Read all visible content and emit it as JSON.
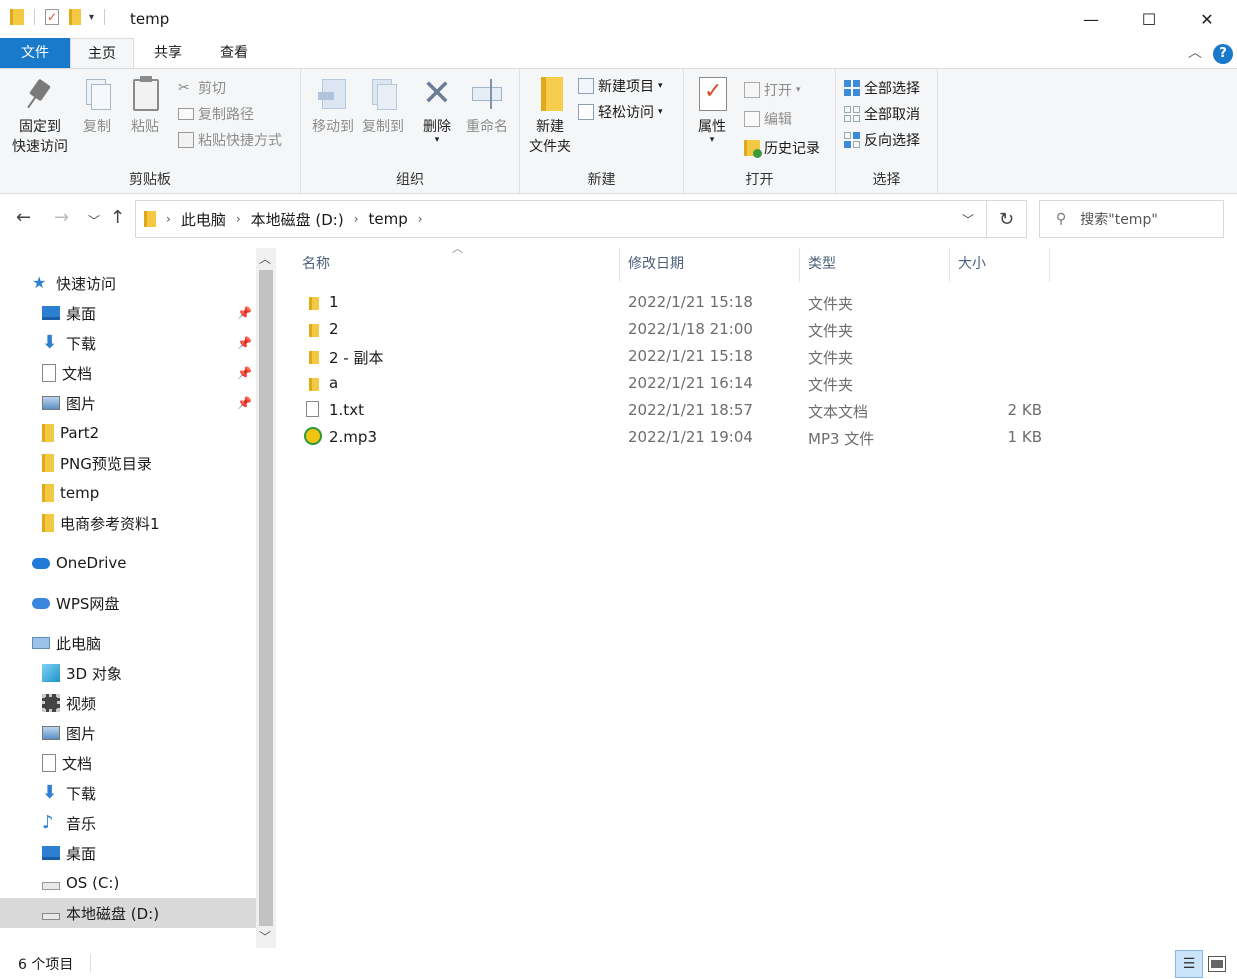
{
  "window": {
    "title": "temp",
    "controls": {
      "minimize": "—",
      "maximize": "☐",
      "close": "✕"
    }
  },
  "tabs": [
    {
      "label": "文件"
    },
    {
      "label": "主页"
    },
    {
      "label": "共享"
    },
    {
      "label": "查看"
    }
  ],
  "ribbon": {
    "clipboard": {
      "label": "剪贴板",
      "pin_line1": "固定到",
      "pin_line2": "快速访问",
      "copy": "复制",
      "paste": "粘贴",
      "cut": "剪切",
      "copy_path": "复制路径",
      "paste_shortcut": "粘贴快捷方式"
    },
    "organize": {
      "label": "组织",
      "move_to": "移动到",
      "copy_to": "复制到",
      "delete": "删除",
      "rename": "重命名"
    },
    "new": {
      "label": "新建",
      "new_folder_line1": "新建",
      "new_folder_line2": "文件夹",
      "new_item": "新建项目",
      "easy_access": "轻松访问"
    },
    "open": {
      "label": "打开",
      "properties": "属性",
      "open": "打开",
      "edit": "编辑",
      "history": "历史记录"
    },
    "select": {
      "label": "选择",
      "select_all": "全部选择",
      "select_none": "全部取消",
      "invert": "反向选择"
    }
  },
  "address": {
    "crumbs": [
      "此电脑",
      "本地磁盘 (D:)",
      "temp"
    ],
    "search_placeholder": "搜索\"temp\""
  },
  "nav": {
    "quick_access": "快速访问",
    "quick_items": [
      "桌面",
      "下载",
      "文档",
      "图片",
      "Part2",
      "PNG预览目录",
      "temp",
      "电商参考资料1"
    ],
    "onedrive": "OneDrive",
    "wps": "WPS网盘",
    "this_pc": "此电脑",
    "pc_items": [
      "3D 对象",
      "视频",
      "图片",
      "文档",
      "下载",
      "音乐",
      "桌面",
      "OS (C:)",
      "本地磁盘 (D:)"
    ]
  },
  "columns": {
    "name": "名称",
    "date": "修改日期",
    "type": "类型",
    "size": "大小"
  },
  "files": [
    {
      "name": "1",
      "date": "2022/1/21 15:18",
      "type": "文件夹",
      "size": "",
      "icon": "folder-icon"
    },
    {
      "name": "2",
      "date": "2022/1/18 21:00",
      "type": "文件夹",
      "size": "",
      "icon": "folder-icon"
    },
    {
      "name": "2 - 副本",
      "date": "2022/1/21 15:18",
      "type": "文件夹",
      "size": "",
      "icon": "folder-icon"
    },
    {
      "name": "a",
      "date": "2022/1/21 16:14",
      "type": "文件夹",
      "size": "",
      "icon": "folder-icon"
    },
    {
      "name": "1.txt",
      "date": "2022/1/21 18:57",
      "type": "文本文档",
      "size": "2 KB",
      "icon": "text-file-icon"
    },
    {
      "name": "2.mp3",
      "date": "2022/1/21 19:04",
      "type": "MP3 文件",
      "size": "1 KB",
      "icon": "music-file-icon"
    }
  ],
  "status": {
    "count": "6 个项目"
  },
  "colors": {
    "accent": "#1979ca",
    "folder": "#f8d775",
    "selection": "#d9d9d9"
  }
}
